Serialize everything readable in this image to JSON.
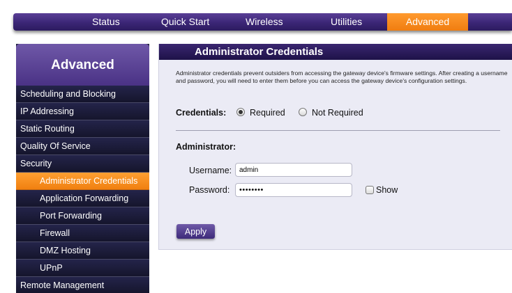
{
  "topnav": {
    "tabs": [
      {
        "label": "Status"
      },
      {
        "label": "Quick Start"
      },
      {
        "label": "Wireless"
      },
      {
        "label": "Utilities"
      },
      {
        "label": "Advanced",
        "active": true
      }
    ]
  },
  "sidebar": {
    "title": "Advanced",
    "items": [
      {
        "label": "Scheduling and Blocking"
      },
      {
        "label": "IP Addressing"
      },
      {
        "label": "Static Routing"
      },
      {
        "label": "Quality Of Service"
      },
      {
        "label": "Security"
      },
      {
        "label": "Administrator Credentials",
        "sub": true,
        "active": true
      },
      {
        "label": "Application Forwarding",
        "sub": true
      },
      {
        "label": "Port Forwarding",
        "sub": true
      },
      {
        "label": "Firewall",
        "sub": true
      },
      {
        "label": "DMZ Hosting",
        "sub": true
      },
      {
        "label": "UPnP",
        "sub": true
      },
      {
        "label": "Remote Management"
      }
    ]
  },
  "main": {
    "title": "Administrator Credentials",
    "description": "Administrator credentials prevent outsiders from accessing the gateway device's firmware settings. After creating a username and password, you will need to enter them before you can access the gateway device's configuration settings.",
    "credentials_label": "Credentials:",
    "option_required": "Required",
    "option_not_required": "Not Required",
    "selected_option": "Required",
    "admin_section_label": "Administrator:",
    "username_label": "Username:",
    "username_value": "admin",
    "password_label": "Password:",
    "password_masked": "••••••••",
    "show_label": "Show",
    "apply_label": "Apply"
  },
  "colors": {
    "nav_purple": "#3b2676",
    "accent_orange": "#f08010",
    "sidebar_dark": "#1f1f3c",
    "panel_bg": "#ebebf5"
  }
}
